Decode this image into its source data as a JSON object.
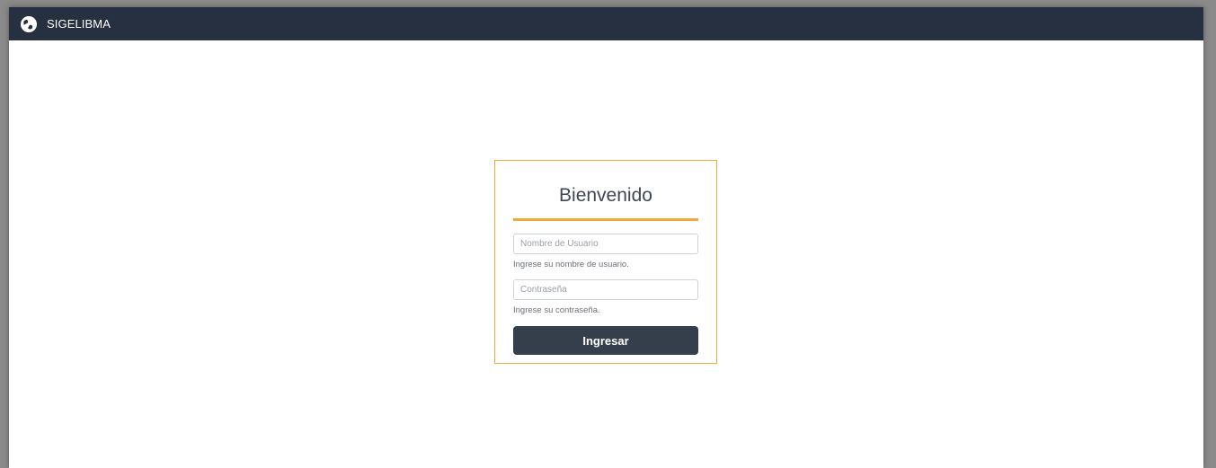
{
  "navbar": {
    "brand_icon": "globe-logo-icon",
    "brand_label": "SIGELIBMA",
    "background": "#263040"
  },
  "login": {
    "title": "Bienvenido",
    "accent_color": "#f0a83a",
    "username": {
      "placeholder": "Nombre de Usuario",
      "value": "",
      "help": "Ingrese su nombre de usuario."
    },
    "password": {
      "placeholder": "Contraseña",
      "value": "",
      "help": "Ingrese su contraseña."
    },
    "submit_label": "Ingresar",
    "submit_color": "#353e4b"
  }
}
